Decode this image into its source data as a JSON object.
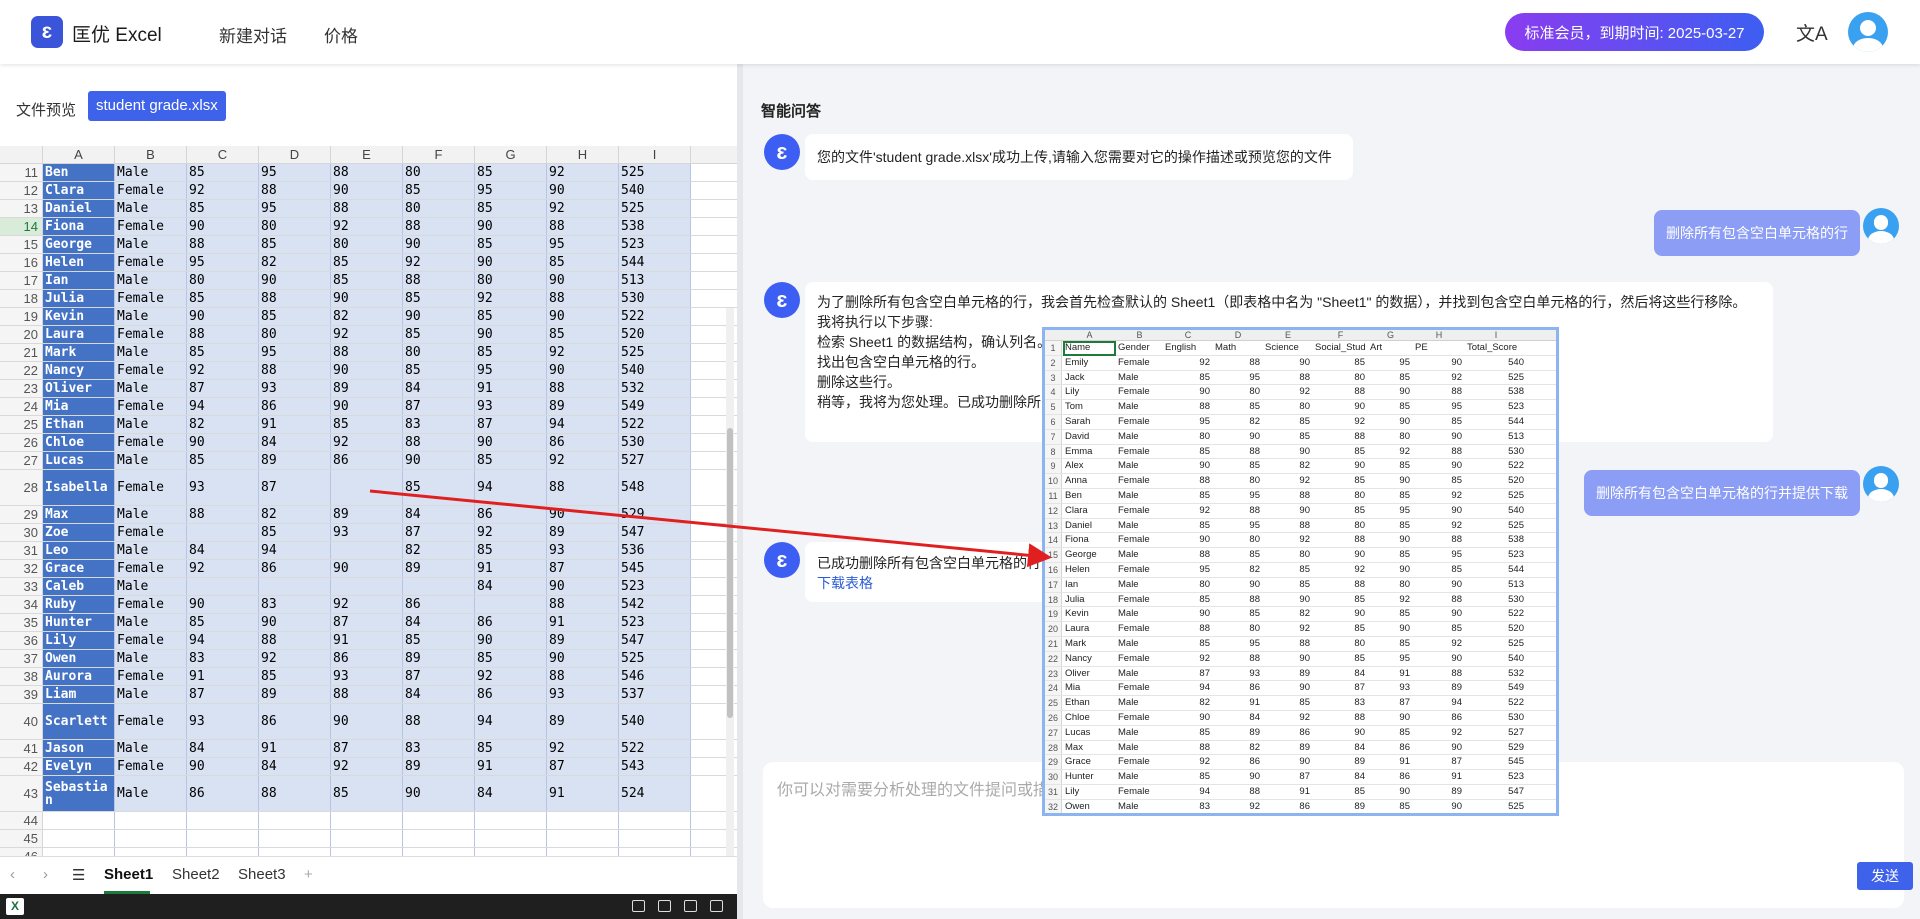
{
  "header": {
    "logo_icon": "ɛ",
    "app_name": "匡优 Excel",
    "nav": [
      "新建对话",
      "价格"
    ],
    "membership": "标准会员，到期时间: 2025-03-27",
    "lang_icon": "文A",
    "icons": {
      "logo": "logo-icon",
      "language": "translate-icon",
      "user": "user-avatar-icon"
    },
    "colors": {
      "accent": "#3f62ea",
      "badge_start": "#8a3cf0",
      "badge_end": "#3d5ef2"
    }
  },
  "left": {
    "preview_label": "文件预览",
    "file_name": "student grade.xlsx",
    "columns": [
      "A",
      "B",
      "C",
      "D",
      "E",
      "F",
      "G",
      "H",
      "I"
    ],
    "rows": [
      {
        "n": "11",
        "c": [
          "Ben",
          "Male",
          "85",
          "95",
          "88",
          "80",
          "85",
          "92",
          "525"
        ]
      },
      {
        "n": "12",
        "c": [
          "Clara",
          "Female",
          "92",
          "88",
          "90",
          "85",
          "95",
          "90",
          "540"
        ]
      },
      {
        "n": "13",
        "c": [
          "Daniel",
          "Male",
          "85",
          "95",
          "88",
          "80",
          "85",
          "92",
          "525"
        ]
      },
      {
        "n": "14",
        "c": [
          "Fiona",
          "Female",
          "90",
          "80",
          "92",
          "88",
          "90",
          "88",
          "538"
        ]
      },
      {
        "n": "15",
        "c": [
          "George",
          "Male",
          "88",
          "85",
          "80",
          "90",
          "85",
          "95",
          "523"
        ]
      },
      {
        "n": "16",
        "c": [
          "Helen",
          "Female",
          "95",
          "82",
          "85",
          "92",
          "90",
          "85",
          "544"
        ]
      },
      {
        "n": "17",
        "c": [
          "Ian",
          "Male",
          "80",
          "90",
          "85",
          "88",
          "80",
          "90",
          "513"
        ]
      },
      {
        "n": "18",
        "c": [
          "Julia",
          "Female",
          "85",
          "88",
          "90",
          "85",
          "92",
          "88",
          "530"
        ]
      },
      {
        "n": "19",
        "c": [
          "Kevin",
          "Male",
          "90",
          "85",
          "82",
          "90",
          "85",
          "90",
          "522"
        ]
      },
      {
        "n": "20",
        "c": [
          "Laura",
          "Female",
          "88",
          "80",
          "92",
          "85",
          "90",
          "85",
          "520"
        ]
      },
      {
        "n": "21",
        "c": [
          "Mark",
          "Male",
          "85",
          "95",
          "88",
          "80",
          "85",
          "92",
          "525"
        ]
      },
      {
        "n": "22",
        "c": [
          "Nancy",
          "Female",
          "92",
          "88",
          "90",
          "85",
          "95",
          "90",
          "540"
        ]
      },
      {
        "n": "23",
        "c": [
          "Oliver",
          "Male",
          "87",
          "93",
          "89",
          "84",
          "91",
          "88",
          "532"
        ]
      },
      {
        "n": "24",
        "c": [
          "Mia",
          "Female",
          "94",
          "86",
          "90",
          "87",
          "93",
          "89",
          "549"
        ]
      },
      {
        "n": "25",
        "c": [
          "Ethan",
          "Male",
          "82",
          "91",
          "85",
          "83",
          "87",
          "94",
          "522"
        ]
      },
      {
        "n": "26",
        "c": [
          "Chloe",
          "Female",
          "90",
          "84",
          "92",
          "88",
          "90",
          "86",
          "530"
        ]
      },
      {
        "n": "27",
        "c": [
          "Lucas",
          "Male",
          "85",
          "89",
          "86",
          "90",
          "85",
          "92",
          "527"
        ]
      },
      {
        "n": "28",
        "c": [
          "Isabella",
          "Female",
          "93",
          "87",
          "",
          "85",
          "94",
          "88",
          "548"
        ]
      },
      {
        "n": "29",
        "c": [
          "Max",
          "Male",
          "88",
          "82",
          "89",
          "84",
          "86",
          "90",
          "529"
        ]
      },
      {
        "n": "30",
        "c": [
          "Zoe",
          "Female",
          "",
          "85",
          "93",
          "87",
          "92",
          "89",
          "547"
        ]
      },
      {
        "n": "31",
        "c": [
          "Leo",
          "Male",
          "84",
          "94",
          "",
          "82",
          "85",
          "93",
          "536"
        ]
      },
      {
        "n": "32",
        "c": [
          "Grace",
          "Female",
          "92",
          "86",
          "90",
          "89",
          "91",
          "87",
          "545"
        ]
      },
      {
        "n": "33",
        "c": [
          "Caleb",
          "Male",
          "",
          "",
          "",
          "",
          "84",
          "90",
          "523"
        ]
      },
      {
        "n": "34",
        "c": [
          "Ruby",
          "Female",
          "90",
          "83",
          "92",
          "86",
          "",
          "88",
          "542"
        ]
      },
      {
        "n": "35",
        "c": [
          "Hunter",
          "Male",
          "85",
          "90",
          "87",
          "84",
          "86",
          "91",
          "523"
        ]
      },
      {
        "n": "36",
        "c": [
          "Lily",
          "Female",
          "94",
          "88",
          "91",
          "85",
          "90",
          "89",
          "547"
        ]
      },
      {
        "n": "37",
        "c": [
          "Owen",
          "Male",
          "83",
          "92",
          "86",
          "89",
          "85",
          "90",
          "525"
        ]
      },
      {
        "n": "38",
        "c": [
          "Aurora",
          "Female",
          "91",
          "85",
          "93",
          "87",
          "92",
          "88",
          "546"
        ]
      },
      {
        "n": "39",
        "c": [
          "Liam",
          "Male",
          "87",
          "89",
          "88",
          "84",
          "86",
          "93",
          "537"
        ]
      },
      {
        "n": "40",
        "c": [
          "Scarlett",
          "Female",
          "93",
          "86",
          "90",
          "88",
          "94",
          "89",
          "540"
        ]
      },
      {
        "n": "41",
        "c": [
          "Jason",
          "Male",
          "84",
          "91",
          "87",
          "83",
          "85",
          "92",
          "522"
        ]
      },
      {
        "n": "42",
        "c": [
          "Evelyn",
          "Female",
          "90",
          "84",
          "92",
          "89",
          "91",
          "87",
          "543"
        ]
      },
      {
        "n": "43",
        "c": [
          "Sebastian",
          "Male",
          "86",
          "88",
          "85",
          "90",
          "84",
          "91",
          "524"
        ]
      },
      {
        "n": "44",
        "c": [
          "",
          "",
          "",
          "",
          "",
          "",
          "",
          "",
          ""
        ]
      },
      {
        "n": "45",
        "c": [
          "",
          "",
          "",
          "",
          "",
          "",
          "",
          "",
          ""
        ]
      },
      {
        "n": "46",
        "c": [
          "",
          "",
          "",
          "",
          "",
          "",
          "",
          "",
          ""
        ]
      }
    ],
    "sheets": [
      "Sheet1",
      "Sheet2",
      "Sheet3"
    ],
    "add_sheet": "+",
    "statusbar_icon": "X",
    "colors": {
      "col_a": "#4472c4",
      "col_b_to_i": "#d9e2f3",
      "active_tab": "#1d7a3a"
    }
  },
  "right": {
    "title": "智能问答",
    "bot_icon": "ɛ",
    "messages": {
      "bot1": "您的文件'student grade.xlsx'成功上传,请输入您需要对它的操作描述或预览您的文件",
      "user1": "删除所有包含空白单元格的行",
      "bot2_lines": [
        "为了删除所有包含空白单元格的行，我会首先检查默认的 Sheet1（即表格中名为 \"Sheet1\" 的数据），并找到包含空白单元格的行，然后将这些行移除。",
        "我将执行以下步骤:",
        "检索 Sheet1 的数据结构，确认列名。",
        "找出包含空白单元格的行。",
        "删除这些行。",
        "稍等，我将为您处理。已成功删除所"
      ],
      "user2": "删除所有包含空白单元格的行并提供下载",
      "bot3": "已成功删除所有包含空白单元格的行",
      "bot3_link": "下载表格"
    },
    "input_placeholder": "你可以对需要分析处理的文件提问或描",
    "send_label": "发送"
  },
  "overlay": {
    "columns": [
      "A",
      "B",
      "C",
      "D",
      "E",
      "F",
      "G",
      "H",
      "I"
    ],
    "header": {
      "n": "1",
      "c": [
        "Name",
        "Gender",
        "English",
        "Math",
        "Science",
        "Social_Stud",
        "Art",
        "PE",
        "Total_Score"
      ]
    },
    "rows": [
      {
        "n": "2",
        "c": [
          "Emily",
          "Female",
          "92",
          "88",
          "90",
          "85",
          "95",
          "90",
          "540"
        ]
      },
      {
        "n": "3",
        "c": [
          "Jack",
          "Male",
          "85",
          "95",
          "88",
          "80",
          "85",
          "92",
          "525"
        ]
      },
      {
        "n": "4",
        "c": [
          "Lily",
          "Female",
          "90",
          "80",
          "92",
          "88",
          "90",
          "88",
          "538"
        ]
      },
      {
        "n": "5",
        "c": [
          "Tom",
          "Male",
          "88",
          "85",
          "80",
          "90",
          "85",
          "95",
          "523"
        ]
      },
      {
        "n": "6",
        "c": [
          "Sarah",
          "Female",
          "95",
          "82",
          "85",
          "92",
          "90",
          "85",
          "544"
        ]
      },
      {
        "n": "7",
        "c": [
          "David",
          "Male",
          "80",
          "90",
          "85",
          "88",
          "80",
          "90",
          "513"
        ]
      },
      {
        "n": "8",
        "c": [
          "Emma",
          "Female",
          "85",
          "88",
          "90",
          "85",
          "92",
          "88",
          "530"
        ]
      },
      {
        "n": "9",
        "c": [
          "Alex",
          "Male",
          "90",
          "85",
          "82",
          "90",
          "85",
          "90",
          "522"
        ]
      },
      {
        "n": "10",
        "c": [
          "Anna",
          "Female",
          "88",
          "80",
          "92",
          "85",
          "90",
          "85",
          "520"
        ]
      },
      {
        "n": "11",
        "c": [
          "Ben",
          "Male",
          "85",
          "95",
          "88",
          "80",
          "85",
          "92",
          "525"
        ]
      },
      {
        "n": "12",
        "c": [
          "Clara",
          "Female",
          "92",
          "88",
          "90",
          "85",
          "95",
          "90",
          "540"
        ]
      },
      {
        "n": "13",
        "c": [
          "Daniel",
          "Male",
          "85",
          "95",
          "88",
          "80",
          "85",
          "92",
          "525"
        ]
      },
      {
        "n": "14",
        "c": [
          "Fiona",
          "Female",
          "90",
          "80",
          "92",
          "88",
          "90",
          "88",
          "538"
        ]
      },
      {
        "n": "15",
        "c": [
          "George",
          "Male",
          "88",
          "85",
          "80",
          "90",
          "85",
          "95",
          "523"
        ]
      },
      {
        "n": "16",
        "c": [
          "Helen",
          "Female",
          "95",
          "82",
          "85",
          "92",
          "90",
          "85",
          "544"
        ]
      },
      {
        "n": "17",
        "c": [
          "Ian",
          "Male",
          "80",
          "90",
          "85",
          "88",
          "80",
          "90",
          "513"
        ]
      },
      {
        "n": "18",
        "c": [
          "Julia",
          "Female",
          "85",
          "88",
          "90",
          "85",
          "92",
          "88",
          "530"
        ]
      },
      {
        "n": "19",
        "c": [
          "Kevin",
          "Male",
          "90",
          "85",
          "82",
          "90",
          "85",
          "90",
          "522"
        ]
      },
      {
        "n": "20",
        "c": [
          "Laura",
          "Female",
          "88",
          "80",
          "92",
          "85",
          "90",
          "85",
          "520"
        ]
      },
      {
        "n": "21",
        "c": [
          "Mark",
          "Male",
          "85",
          "95",
          "88",
          "80",
          "85",
          "92",
          "525"
        ]
      },
      {
        "n": "22",
        "c": [
          "Nancy",
          "Female",
          "92",
          "88",
          "90",
          "85",
          "95",
          "90",
          "540"
        ]
      },
      {
        "n": "23",
        "c": [
          "Oliver",
          "Male",
          "87",
          "93",
          "89",
          "84",
          "91",
          "88",
          "532"
        ]
      },
      {
        "n": "24",
        "c": [
          "Mia",
          "Female",
          "94",
          "86",
          "90",
          "87",
          "93",
          "89",
          "549"
        ]
      },
      {
        "n": "25",
        "c": [
          "Ethan",
          "Male",
          "82",
          "91",
          "85",
          "83",
          "87",
          "94",
          "522"
        ]
      },
      {
        "n": "26",
        "c": [
          "Chloe",
          "Female",
          "90",
          "84",
          "92",
          "88",
          "90",
          "86",
          "530"
        ]
      },
      {
        "n": "27",
        "c": [
          "Lucas",
          "Male",
          "85",
          "89",
          "86",
          "90",
          "85",
          "92",
          "527"
        ]
      },
      {
        "n": "28",
        "c": [
          "Max",
          "Male",
          "88",
          "82",
          "89",
          "84",
          "86",
          "90",
          "529"
        ]
      },
      {
        "n": "29",
        "c": [
          "Grace",
          "Female",
          "92",
          "86",
          "90",
          "89",
          "91",
          "87",
          "545"
        ]
      },
      {
        "n": "30",
        "c": [
          "Hunter",
          "Male",
          "85",
          "90",
          "87",
          "84",
          "86",
          "91",
          "523"
        ]
      },
      {
        "n": "31",
        "c": [
          "Lily",
          "Female",
          "94",
          "88",
          "91",
          "85",
          "90",
          "89",
          "547"
        ]
      },
      {
        "n": "32",
        "c": [
          "Owen",
          "Male",
          "83",
          "92",
          "86",
          "89",
          "85",
          "90",
          "525"
        ]
      }
    ],
    "border_color": "#8cb4f0"
  },
  "annotation": {
    "arrow_color": "#e02020"
  }
}
